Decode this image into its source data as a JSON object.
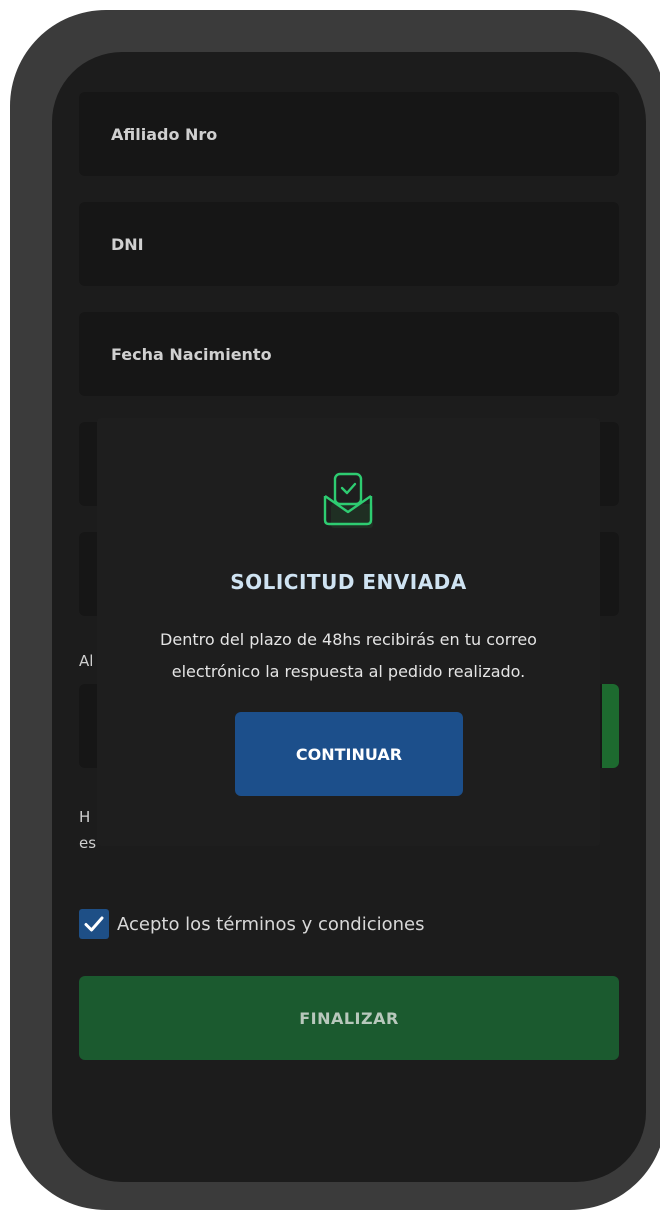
{
  "form": {
    "fields": [
      {
        "label": "Afiliado Nro"
      },
      {
        "label": "DNI"
      },
      {
        "label": "Fecha Nacimiento"
      }
    ],
    "partial_label": "Al",
    "partial_text_line1": "H",
    "partial_text_line2": "es",
    "terms_label": "Acepto los términos y condiciones",
    "terms_checked": true,
    "finish_label": "FINALIZAR"
  },
  "modal": {
    "icon": "envelope-check-icon",
    "title": "SOLICITUD ENVIADA",
    "message": "Dentro del plazo de 48hs recibirás en tu correo electrónico la respuesta al pedido realizado.",
    "continue_label": "CONTINUAR"
  },
  "colors": {
    "background": "#1c1c1c",
    "accent_green": "#1b5a2f",
    "accent_blue": "#1c4f8b",
    "icon_green": "#2ecc71"
  }
}
